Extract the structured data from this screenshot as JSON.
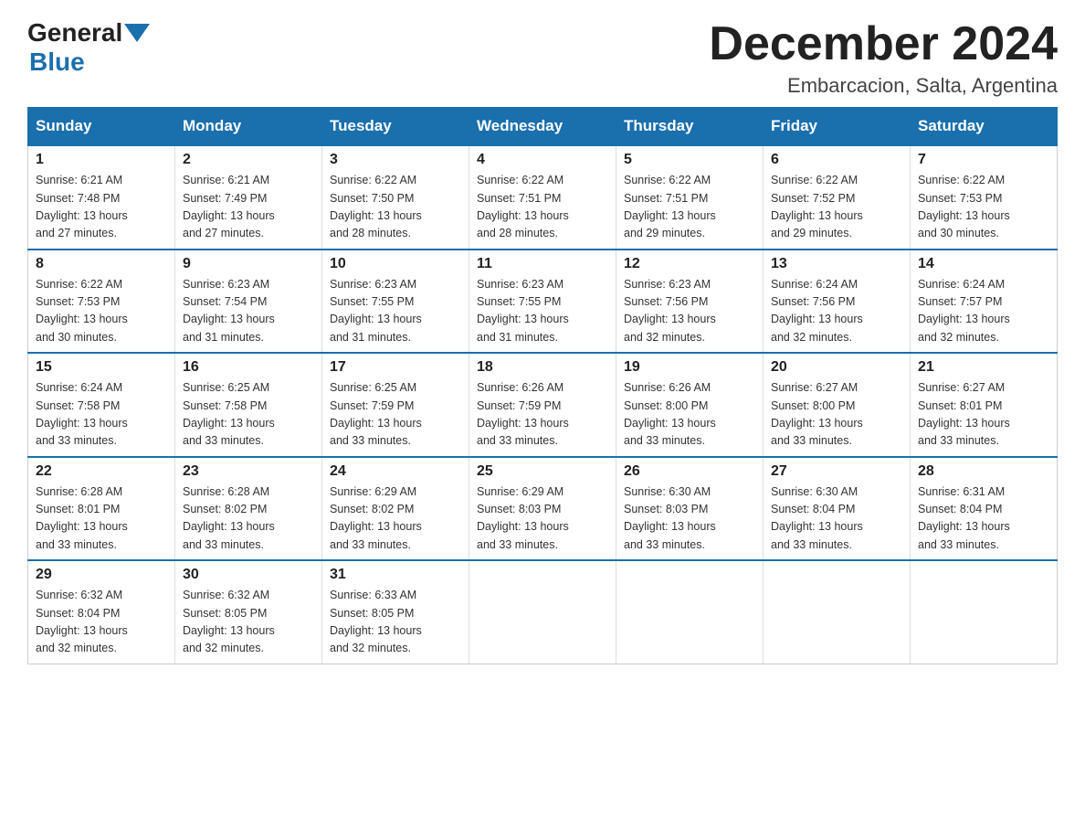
{
  "header": {
    "logo_general": "General",
    "logo_blue": "Blue",
    "month_title": "December 2024",
    "location": "Embarcacion, Salta, Argentina"
  },
  "weekdays": [
    "Sunday",
    "Monday",
    "Tuesday",
    "Wednesday",
    "Thursday",
    "Friday",
    "Saturday"
  ],
  "weeks": [
    [
      {
        "day": "1",
        "sunrise": "6:21 AM",
        "sunset": "7:48 PM",
        "daylight": "13 hours and 27 minutes."
      },
      {
        "day": "2",
        "sunrise": "6:21 AM",
        "sunset": "7:49 PM",
        "daylight": "13 hours and 27 minutes."
      },
      {
        "day": "3",
        "sunrise": "6:22 AM",
        "sunset": "7:50 PM",
        "daylight": "13 hours and 28 minutes."
      },
      {
        "day": "4",
        "sunrise": "6:22 AM",
        "sunset": "7:51 PM",
        "daylight": "13 hours and 28 minutes."
      },
      {
        "day": "5",
        "sunrise": "6:22 AM",
        "sunset": "7:51 PM",
        "daylight": "13 hours and 29 minutes."
      },
      {
        "day": "6",
        "sunrise": "6:22 AM",
        "sunset": "7:52 PM",
        "daylight": "13 hours and 29 minutes."
      },
      {
        "day": "7",
        "sunrise": "6:22 AM",
        "sunset": "7:53 PM",
        "daylight": "13 hours and 30 minutes."
      }
    ],
    [
      {
        "day": "8",
        "sunrise": "6:22 AM",
        "sunset": "7:53 PM",
        "daylight": "13 hours and 30 minutes."
      },
      {
        "day": "9",
        "sunrise": "6:23 AM",
        "sunset": "7:54 PM",
        "daylight": "13 hours and 31 minutes."
      },
      {
        "day": "10",
        "sunrise": "6:23 AM",
        "sunset": "7:55 PM",
        "daylight": "13 hours and 31 minutes."
      },
      {
        "day": "11",
        "sunrise": "6:23 AM",
        "sunset": "7:55 PM",
        "daylight": "13 hours and 31 minutes."
      },
      {
        "day": "12",
        "sunrise": "6:23 AM",
        "sunset": "7:56 PM",
        "daylight": "13 hours and 32 minutes."
      },
      {
        "day": "13",
        "sunrise": "6:24 AM",
        "sunset": "7:56 PM",
        "daylight": "13 hours and 32 minutes."
      },
      {
        "day": "14",
        "sunrise": "6:24 AM",
        "sunset": "7:57 PM",
        "daylight": "13 hours and 32 minutes."
      }
    ],
    [
      {
        "day": "15",
        "sunrise": "6:24 AM",
        "sunset": "7:58 PM",
        "daylight": "13 hours and 33 minutes."
      },
      {
        "day": "16",
        "sunrise": "6:25 AM",
        "sunset": "7:58 PM",
        "daylight": "13 hours and 33 minutes."
      },
      {
        "day": "17",
        "sunrise": "6:25 AM",
        "sunset": "7:59 PM",
        "daylight": "13 hours and 33 minutes."
      },
      {
        "day": "18",
        "sunrise": "6:26 AM",
        "sunset": "7:59 PM",
        "daylight": "13 hours and 33 minutes."
      },
      {
        "day": "19",
        "sunrise": "6:26 AM",
        "sunset": "8:00 PM",
        "daylight": "13 hours and 33 minutes."
      },
      {
        "day": "20",
        "sunrise": "6:27 AM",
        "sunset": "8:00 PM",
        "daylight": "13 hours and 33 minutes."
      },
      {
        "day": "21",
        "sunrise": "6:27 AM",
        "sunset": "8:01 PM",
        "daylight": "13 hours and 33 minutes."
      }
    ],
    [
      {
        "day": "22",
        "sunrise": "6:28 AM",
        "sunset": "8:01 PM",
        "daylight": "13 hours and 33 minutes."
      },
      {
        "day": "23",
        "sunrise": "6:28 AM",
        "sunset": "8:02 PM",
        "daylight": "13 hours and 33 minutes."
      },
      {
        "day": "24",
        "sunrise": "6:29 AM",
        "sunset": "8:02 PM",
        "daylight": "13 hours and 33 minutes."
      },
      {
        "day": "25",
        "sunrise": "6:29 AM",
        "sunset": "8:03 PM",
        "daylight": "13 hours and 33 minutes."
      },
      {
        "day": "26",
        "sunrise": "6:30 AM",
        "sunset": "8:03 PM",
        "daylight": "13 hours and 33 minutes."
      },
      {
        "day": "27",
        "sunrise": "6:30 AM",
        "sunset": "8:04 PM",
        "daylight": "13 hours and 33 minutes."
      },
      {
        "day": "28",
        "sunrise": "6:31 AM",
        "sunset": "8:04 PM",
        "daylight": "13 hours and 33 minutes."
      }
    ],
    [
      {
        "day": "29",
        "sunrise": "6:32 AM",
        "sunset": "8:04 PM",
        "daylight": "13 hours and 32 minutes."
      },
      {
        "day": "30",
        "sunrise": "6:32 AM",
        "sunset": "8:05 PM",
        "daylight": "13 hours and 32 minutes."
      },
      {
        "day": "31",
        "sunrise": "6:33 AM",
        "sunset": "8:05 PM",
        "daylight": "13 hours and 32 minutes."
      },
      null,
      null,
      null,
      null
    ]
  ],
  "labels": {
    "sunrise": "Sunrise:",
    "sunset": "Sunset:",
    "daylight": "Daylight:"
  }
}
